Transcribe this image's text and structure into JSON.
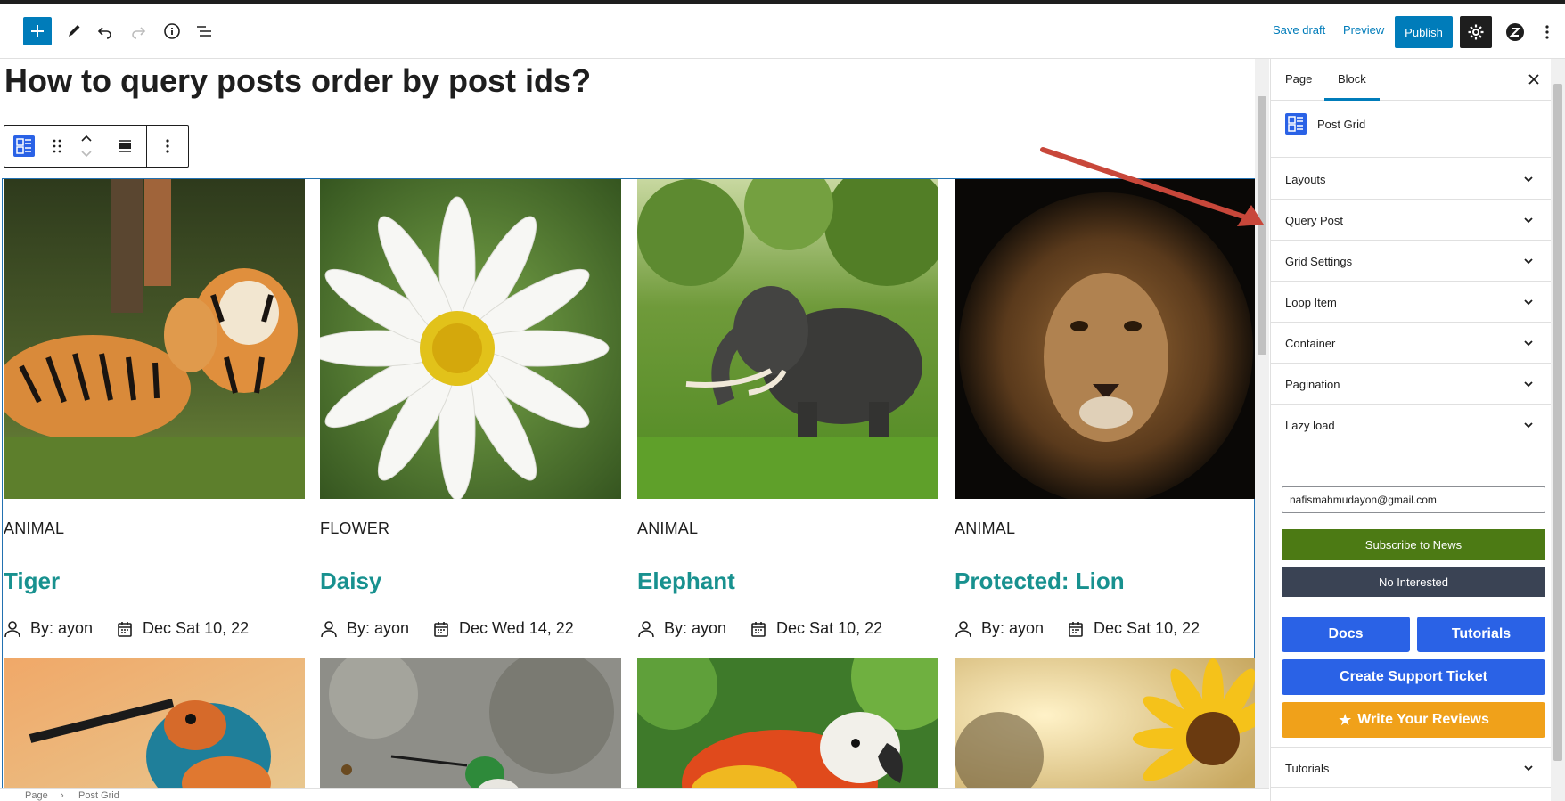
{
  "toolbar": {
    "save_draft": "Save draft",
    "preview": "Preview",
    "publish": "Publish"
  },
  "post": {
    "title": "How to query posts order by post ids?"
  },
  "posts": [
    {
      "category": "ANIMAL",
      "title": "Tiger",
      "author": "By: ayon",
      "date": "Dec Sat 10, 22"
    },
    {
      "category": "FLOWER",
      "title": "Daisy",
      "author": "By: ayon",
      "date": "Dec Wed 14, 22"
    },
    {
      "category": "ANIMAL",
      "title": "Elephant",
      "author": "By: ayon",
      "date": "Dec Sat 10, 22"
    },
    {
      "category": "ANIMAL",
      "title": "Protected: Lion",
      "author": "By: ayon",
      "date": "Dec Sat 10, 22"
    }
  ],
  "sidebar": {
    "tabs": [
      "Page",
      "Block"
    ],
    "active_tab": "Block",
    "block_name": "Post Grid",
    "panels": [
      "Layouts",
      "Query Post",
      "Grid Settings",
      "Loop Item",
      "Container",
      "Pagination",
      "Lazy load"
    ],
    "email_value": "nafismahmudayon@gmail.com",
    "subscribe_label": "Subscribe to News",
    "no_interest_label": "No Interested",
    "docs_label": "Docs",
    "tutorials_label": "Tutorials",
    "support_label": "Create Support Ticket",
    "reviews_label": "Write Your Reviews",
    "bottom_panel": "Tutorials"
  },
  "breadcrumb": [
    "Page",
    "Post Grid"
  ],
  "colors": {
    "accent": "#007cba",
    "post_title": "#18918f",
    "subscribe": "#4c7a14",
    "no_interest": "#3a4354",
    "help_buttons": "#2a62e6",
    "reviews": "#f0a11a",
    "annotation_arrow": "#c8473a"
  }
}
